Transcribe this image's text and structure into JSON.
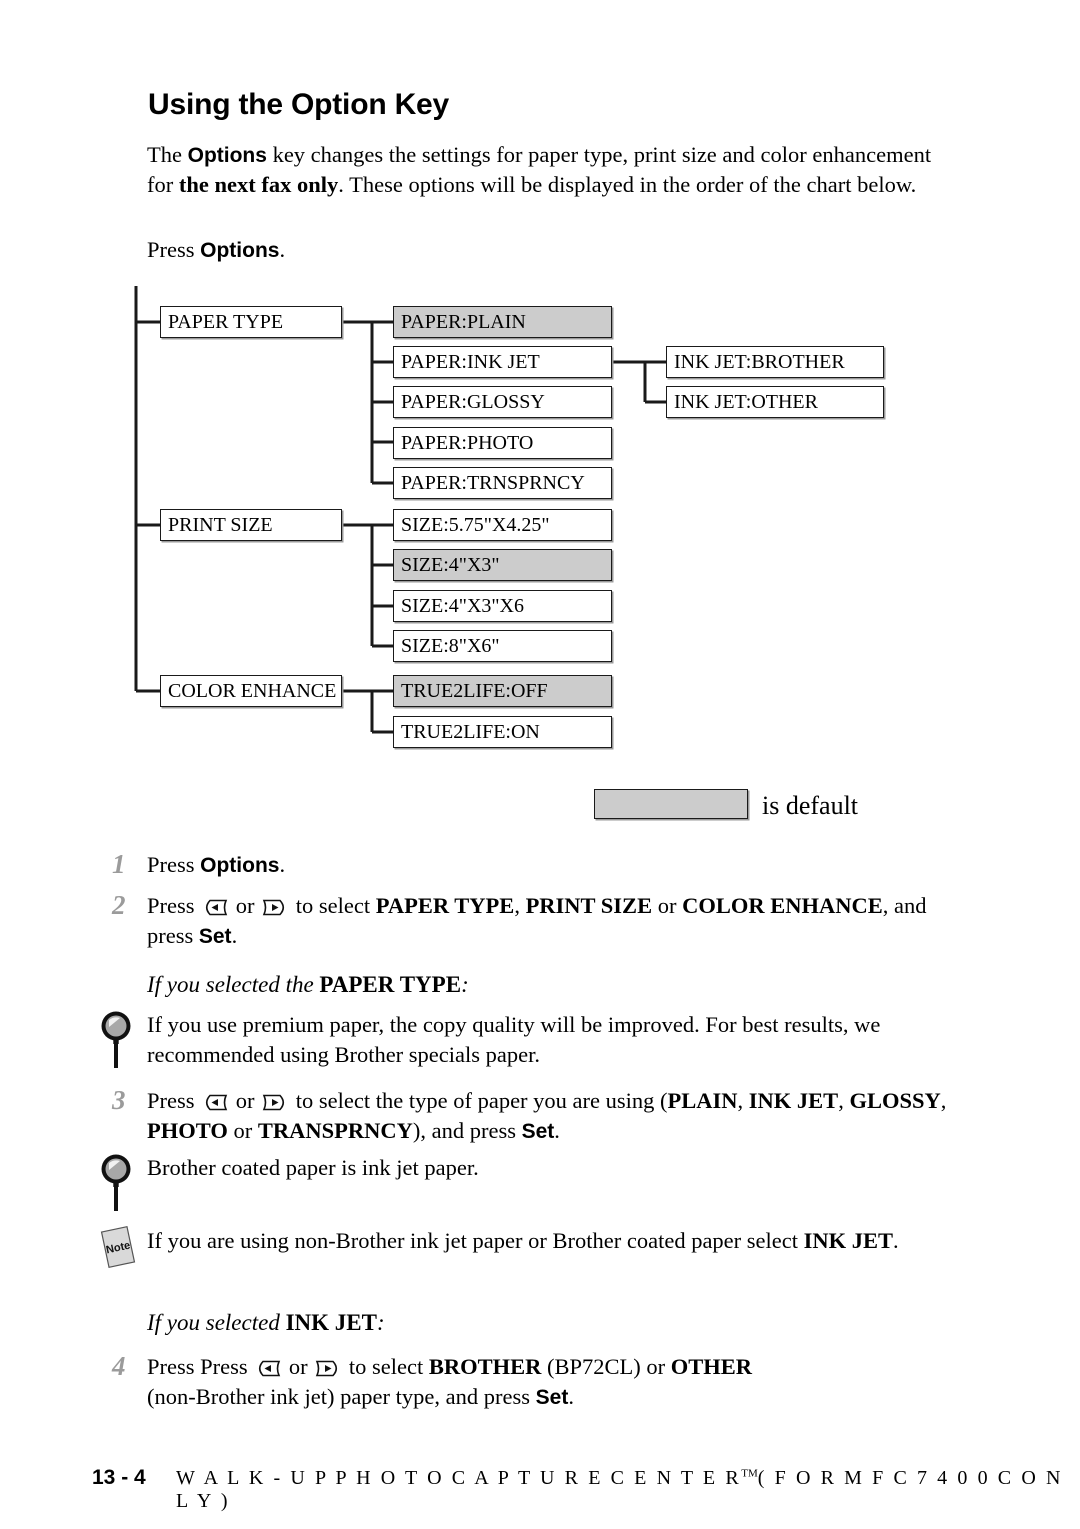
{
  "heading": "Using the Option Key",
  "intro": {
    "t1": "The ",
    "b1": "Options",
    "t2": " key changes the settings for paper type, print size and color enhancement for ",
    "b2": "the next fax only",
    "t3": ". These options will be displayed in the order of the chart below."
  },
  "press_options": {
    "pre": "Press ",
    "key": "Options",
    "post": "."
  },
  "chart_data": {
    "type": "diagram",
    "title": "Options key menu tree",
    "legend": {
      "swatch_color": "#cccccc",
      "label": "is default"
    },
    "levels": [
      {
        "name": "PAPER TYPE",
        "children": [
          {
            "name": "PAPER:PLAIN",
            "default": true
          },
          {
            "name": "PAPER:INK JET",
            "default": false,
            "children": [
              {
                "name": "INK JET:BROTHER",
                "default": false
              },
              {
                "name": "INK JET:OTHER",
                "default": false
              }
            ]
          },
          {
            "name": "PAPER:GLOSSY",
            "default": false
          },
          {
            "name": "PAPER:PHOTO",
            "default": false
          },
          {
            "name": "PAPER:TRNSPRNCY",
            "default": false
          }
        ]
      },
      {
        "name": "PRINT SIZE",
        "children": [
          {
            "name": "SIZE:5.75\"X4.25\"",
            "default": false
          },
          {
            "name": "SIZE:4\"X3\"",
            "default": true
          },
          {
            "name": "SIZE:4\"X3\"X6",
            "default": false
          },
          {
            "name": "SIZE:8\"X6\"",
            "default": false
          }
        ]
      },
      {
        "name": "COLOR ENHANCE",
        "children": [
          {
            "name": "TRUE2LIFE:OFF",
            "default": true
          },
          {
            "name": "TRUE2LIFE:ON",
            "default": false
          }
        ]
      }
    ]
  },
  "chart_boxes": {
    "l1": [
      "PAPER TYPE",
      "PRINT SIZE",
      "COLOR ENHANCE"
    ],
    "l2": [
      "PAPER:PLAIN",
      "PAPER:INK JET",
      "PAPER:GLOSSY",
      "PAPER:PHOTO",
      "PAPER:TRNSPRNCY",
      "SIZE:5.75\"X4.25\"",
      "SIZE:4\"X3\"",
      "SIZE:4\"X3\"X6",
      "SIZE:8\"X6\"",
      "TRUE2LIFE:OFF",
      "TRUE2LIFE:ON"
    ],
    "l3": [
      "INK JET:BROTHER",
      "INK JET:OTHER"
    ]
  },
  "legend": {
    "label": "is default"
  },
  "steps": {
    "s1": {
      "num": "1",
      "pre": "Press ",
      "key": "Options",
      "post": "."
    },
    "s2": {
      "num": "2",
      "p1": "Press ",
      "p2": " or ",
      "p3": " to select ",
      "b1": "PAPER TYPE",
      "b1tail": ", ",
      "b2": "PRINT SIZE",
      "b2tail": " or ",
      "b3": "COLOR ENHANCE",
      "b3tail": ", and press ",
      "key": "Set",
      "end": "."
    },
    "h1": {
      "pre": "If you selected the ",
      "bold": "PAPER TYPE",
      "post": ":"
    },
    "tip1": "If you use premium paper, the copy quality will be improved. For best results, we recommended using Brother specials paper.",
    "s3": {
      "num": "3",
      "p1": "Press ",
      "p2": " or ",
      "p3": " to select the type of paper you are using (",
      "b1": "PLAIN",
      "b1tail": ", ",
      "b2": "INK JET",
      "b2tail": ", ",
      "b3": "GLOSSY",
      "b3tail": ", ",
      "b4": "PHOTO",
      "b4tail": " or ",
      "b5": "TRANSPRNCY",
      "b5tail": "), and press ",
      "key": "Set",
      "end": "."
    },
    "tip2": "Brother coated paper is ink jet paper.",
    "note1": {
      "text": "If you are using non-Brother ink jet paper or Brother coated paper select ",
      "bold": "INK JET",
      "post": "."
    },
    "h2": {
      "pre": "If you selected ",
      "bold": "INK JET",
      "post": ":"
    },
    "s4": {
      "num": "4",
      "p1": "Press Press ",
      "p2": " or ",
      "p3": " to select ",
      "b1": "BROTHER",
      "b1tail": " (BP72CL) or ",
      "b2": "OTHER",
      "b2tail": " (non-Brother ink jet) paper type, and press ",
      "key": "Set",
      "end": ".",
      "line2pre": "(non-Brother ink jet) paper type, and press "
    }
  },
  "icons": {
    "note_label": "Note"
  },
  "footer": {
    "page": "13 - 4",
    "text": "W A L K - U P   P H O T O C A P T U R E   C E N T E R",
    "tm": "TM",
    "text2": "( F O R   M F C   7 4 0 0 C   O N L Y )"
  }
}
